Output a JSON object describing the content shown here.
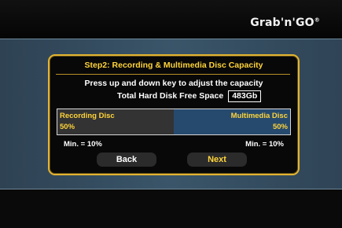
{
  "brand": {
    "name": "Grab'n'GO",
    "mark": "®"
  },
  "dialog": {
    "title": "Step2: Recording & Multimedia Disc Capacity",
    "instruction": "Press up and down key to adjust the capacity",
    "free_space_label": "Total Hard Disk Free Space",
    "free_space_value": "483Gb",
    "recording": {
      "label": "Recording Disc",
      "value": "50%"
    },
    "multimedia": {
      "label": "Multimedia Disc",
      "value": "50%"
    },
    "min_recording": "Min. = 10%",
    "min_multimedia": "Min. = 10%",
    "back_label": "Back",
    "next_label": "Next"
  },
  "colors": {
    "accent": "#ffd43a",
    "frame": "#e3b431",
    "multimedia_pane": "#264a6e",
    "recording_pane": "#333333"
  }
}
